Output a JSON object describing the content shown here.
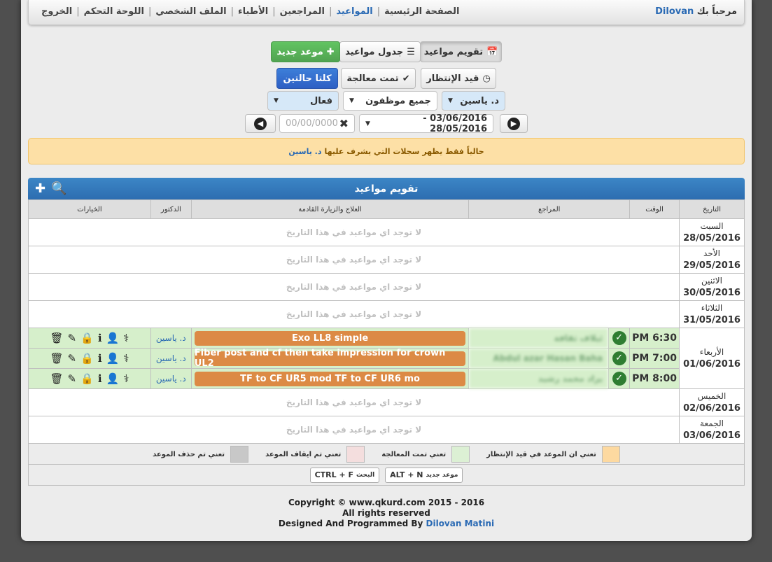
{
  "topbar": {
    "welcome_prefix": "مرحباً بك",
    "username": "Dilovan",
    "nav": [
      "الصفحة الرئيسية",
      "المواعيد",
      "المراجعين",
      "الأطباء",
      "الملف الشخصي",
      "اللوحة التحكم",
      "الخروج"
    ],
    "active_nav": "المواعيد"
  },
  "toolbar": {
    "calendar_label": "تقويم مواعيد",
    "table_label": "جدول مواعيد",
    "new_label": "موعد جديد",
    "waiting_label": "قيد الإنتظار",
    "treated_label": "تمت معالجة",
    "both_label": "كلتا حالتين"
  },
  "filters": {
    "doctor": "د. ياسين",
    "staff": "جميع موظفون",
    "status": "فعال",
    "date_range": "03/06/2016 - 28/05/2016",
    "date_placeholder": "00/00/0000"
  },
  "alert": {
    "text": "حالياً فقط يظهر سجلات التي يشرف عليها",
    "doctor": "د. ياسين"
  },
  "calendar": {
    "title": "تقويم مواعيد",
    "headers": {
      "date": "التاريخ",
      "time": "الوقت",
      "patient": "المراجع",
      "treatment": "العلاج والزيارة القادمة",
      "doctor": "الدكتور",
      "options": "الخيارات"
    },
    "empty_text": "لا توجد اي مواعيد في هذا التاريخ",
    "days": [
      {
        "name": "السبت",
        "date": "28/05/2016"
      },
      {
        "name": "الأحد",
        "date": "29/05/2016"
      },
      {
        "name": "الاثنين",
        "date": "30/05/2016"
      },
      {
        "name": "الثلاثاء",
        "date": "31/05/2016"
      },
      {
        "name": "الأربعاء",
        "date": "01/06/2016"
      },
      {
        "name": "الخميس",
        "date": "02/06/2016"
      },
      {
        "name": "الجمعة",
        "date": "03/06/2016"
      }
    ],
    "appointments": [
      {
        "time": "PM 6:30",
        "patient": "ئيلاف ثقافة",
        "treatment": "Exo LL8 simple",
        "doctor": "د. ياسين"
      },
      {
        "time": "PM 7:00",
        "patient": "Abdul azar Hasan Baha",
        "treatment": "Fiber post and cf then take impression for crown UL2",
        "doctor": "د. ياسين"
      },
      {
        "time": "PM 8:00",
        "patient": "يزاد محمد رشيد",
        "treatment": "TF to CF UR5 mod TF to CF UR6 mo",
        "doctor": "د. ياسين"
      }
    ]
  },
  "legend": [
    {
      "label": "تعني ان الموعد في قيد الإنتظار",
      "color": "#fdd9a0"
    },
    {
      "label": "تعني تمت المعالجة",
      "color": "#dcf0d4"
    },
    {
      "label": "تعني تم ايقاف الموعد",
      "color": "#f4dede"
    },
    {
      "label": "تعني تم حذف الموعد",
      "color": "#c8c8c8"
    }
  ],
  "shortcuts": [
    {
      "keys": "ALT + N",
      "label": "موعد جديد"
    },
    {
      "keys": "CTRL + F",
      "label": "البحث"
    }
  ],
  "footer": {
    "copyright": "Copyright © www.qkurd.com 2015 - 2016",
    "rights": "All rights reserved",
    "designed": "Designed And Programmed By",
    "author": "Dilovan Matini"
  }
}
